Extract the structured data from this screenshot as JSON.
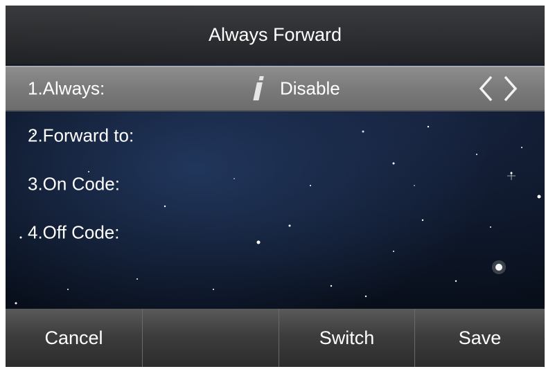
{
  "title": "Always Forward",
  "rows": [
    {
      "label": "1.Always:",
      "value": "Disable",
      "selected": true
    },
    {
      "label": "2.Forward to:",
      "value": ""
    },
    {
      "label": "3.On Code:",
      "value": ""
    },
    {
      "label": "4.Off Code:",
      "value": ""
    }
  ],
  "icons": {
    "info": "info-icon",
    "left": "chevron-left-icon",
    "right": "chevron-right-icon"
  },
  "softkeys": [
    "Cancel",
    "",
    "Switch",
    "Save"
  ],
  "colors": {
    "title_bar": "#3a3a3a",
    "selected_row": "#808080",
    "softkey": "#3d3d3d",
    "text": "#ffffff",
    "background": "#0a1220"
  }
}
